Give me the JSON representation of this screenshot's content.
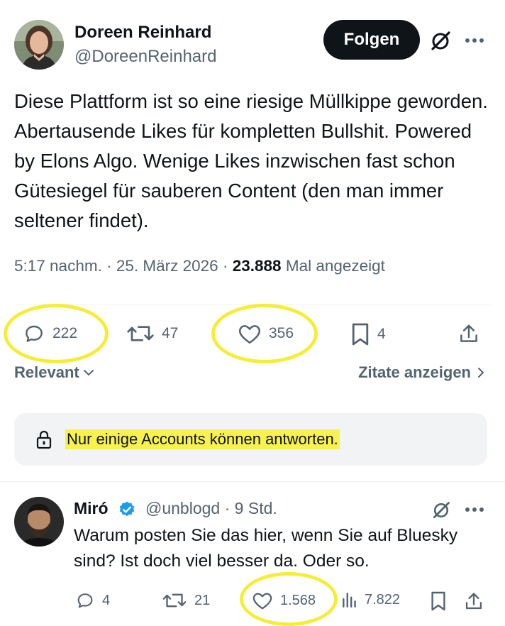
{
  "post": {
    "author_name": "Doreen Reinhard",
    "author_handle": "@DoreenReinhard",
    "follow_label": "Folgen",
    "text": "Diese Plattform ist so eine riesige Müllkippe geworden. Abertausende Likes für kompletten Bullshit. Powered by Elons Algo. Wenige Likes inzwischen fast schon Gütesiegel für sauberen Content (den man immer seltener findet).",
    "time": "5:17 nachm.",
    "date": "25. März 2026",
    "views": "23.888",
    "views_label": "Mal angezeigt",
    "sep": "·",
    "stats": {
      "replies": "222",
      "reposts": "47",
      "likes": "356",
      "bookmarks": "4"
    }
  },
  "sort": {
    "label": "Relevant",
    "quotes_label": "Zitate anzeigen"
  },
  "restriction": {
    "text": "Nur einige Accounts können antworten."
  },
  "reply": {
    "name": "Miró",
    "handle": "@unblogd",
    "sep": "·",
    "age": "9 Std.",
    "text": "Warum posten Sie das hier, wenn Sie auf Bluesky sind?  Ist doch viel besser da. Oder so.",
    "stats": {
      "replies": "4",
      "reposts": "21",
      "likes": "1.568",
      "views": "7.822"
    }
  },
  "colors": {
    "text": "#0f1419",
    "muted": "#536471",
    "verified": "#1d9bf0",
    "highlight": "#f4ee3a"
  }
}
